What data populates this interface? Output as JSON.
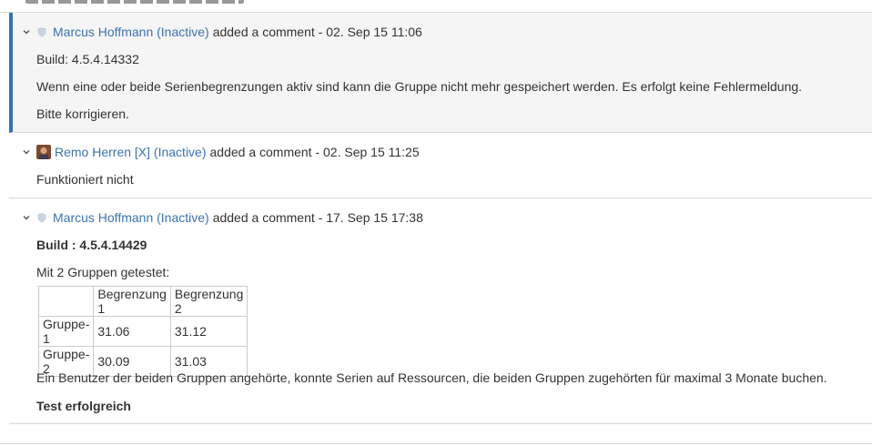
{
  "comments": [
    {
      "author": "Marcus Hoffmann (Inactive)",
      "action": "added a comment - 02. Sep 15 11:06",
      "paragraphs": [
        "Build: 4.5.4.14332",
        "Wenn eine oder beide Serienbegrenzungen aktiv sind kann die Gruppe nicht mehr gespeichert werden. Es erfolgt keine Fehlermeldung.",
        "Bitte korrigieren."
      ]
    },
    {
      "author": "Remo Herren [X] (Inactive)",
      "action": "added a comment - 02. Sep 15 11:25",
      "paragraphs": [
        "Funktioniert nicht"
      ]
    },
    {
      "author": "Marcus Hoffmann (Inactive)",
      "action": "added a comment - 17. Sep 15 17:38",
      "build": "Build : 4.5.4.14429",
      "intro": "Mit 2 Gruppen getestet:",
      "table": {
        "header": [
          "",
          "Begrenzung 1",
          "Begrenzung 2"
        ],
        "rows": [
          [
            "Gruppe-1",
            "31.06",
            "31.12"
          ],
          [
            "Gruppe-2",
            "30.09",
            "31.03"
          ]
        ]
      },
      "result_text": "Ein Benutzer der beiden Gruppen angehörte, konnte Serien auf Ressourcen, die beiden Gruppen zugehörten für maximal 3 Monate buchen.",
      "conclusion": "Test erfolgreich"
    }
  ],
  "colors": {
    "accent": "#3572b0",
    "link": "#3b73af",
    "highlight_bg": "#f5f5f5"
  }
}
